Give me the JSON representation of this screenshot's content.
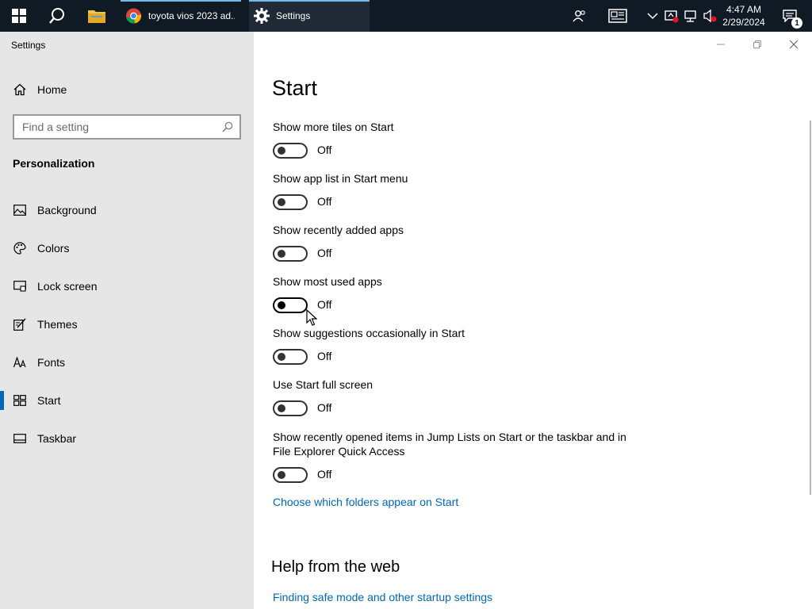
{
  "taskbar": {
    "apps": [
      {
        "label": "toyota vios 2023 ad...",
        "icon": "chrome-icon"
      },
      {
        "label": "Settings",
        "icon": "gear-icon"
      }
    ],
    "clock": {
      "time": "4:47 AM",
      "date": "2/29/2024"
    },
    "notification_count": "1"
  },
  "window": {
    "title": "Settings"
  },
  "nav": {
    "home_label": "Home",
    "search_placeholder": "Find a setting",
    "section_heading": "Personalization",
    "items": [
      {
        "label": "Background",
        "icon": "picture-icon"
      },
      {
        "label": "Colors",
        "icon": "palette-icon"
      },
      {
        "label": "Lock screen",
        "icon": "lock-screen-icon"
      },
      {
        "label": "Themes",
        "icon": "brush-icon"
      },
      {
        "label": "Fonts",
        "icon": "font-icon"
      },
      {
        "label": "Start",
        "icon": "start-tiles-icon",
        "selected": true
      },
      {
        "label": "Taskbar",
        "icon": "taskbar-icon"
      }
    ]
  },
  "main": {
    "title": "Start",
    "settings": [
      {
        "label": "Show more tiles on Start",
        "state": "Off"
      },
      {
        "label": "Show app list in Start menu",
        "state": "Off"
      },
      {
        "label": "Show recently added apps",
        "state": "Off"
      },
      {
        "label": "Show most used apps",
        "state": "Off"
      },
      {
        "label": "Show suggestions occasionally in Start",
        "state": "Off"
      },
      {
        "label": "Use Start full screen",
        "state": "Off"
      },
      {
        "label": "Show recently opened items in Jump Lists on Start or the taskbar and in File Explorer Quick Access",
        "state": "Off"
      }
    ],
    "folders_link": "Choose which folders appear on Start",
    "help": {
      "title": "Help from the web",
      "link": "Finding safe mode and other startup settings"
    }
  },
  "colors": {
    "taskbar": "#101a24",
    "nav_background": "#e6e6e6",
    "accent": "#0067c0",
    "link": "#0067b8"
  }
}
